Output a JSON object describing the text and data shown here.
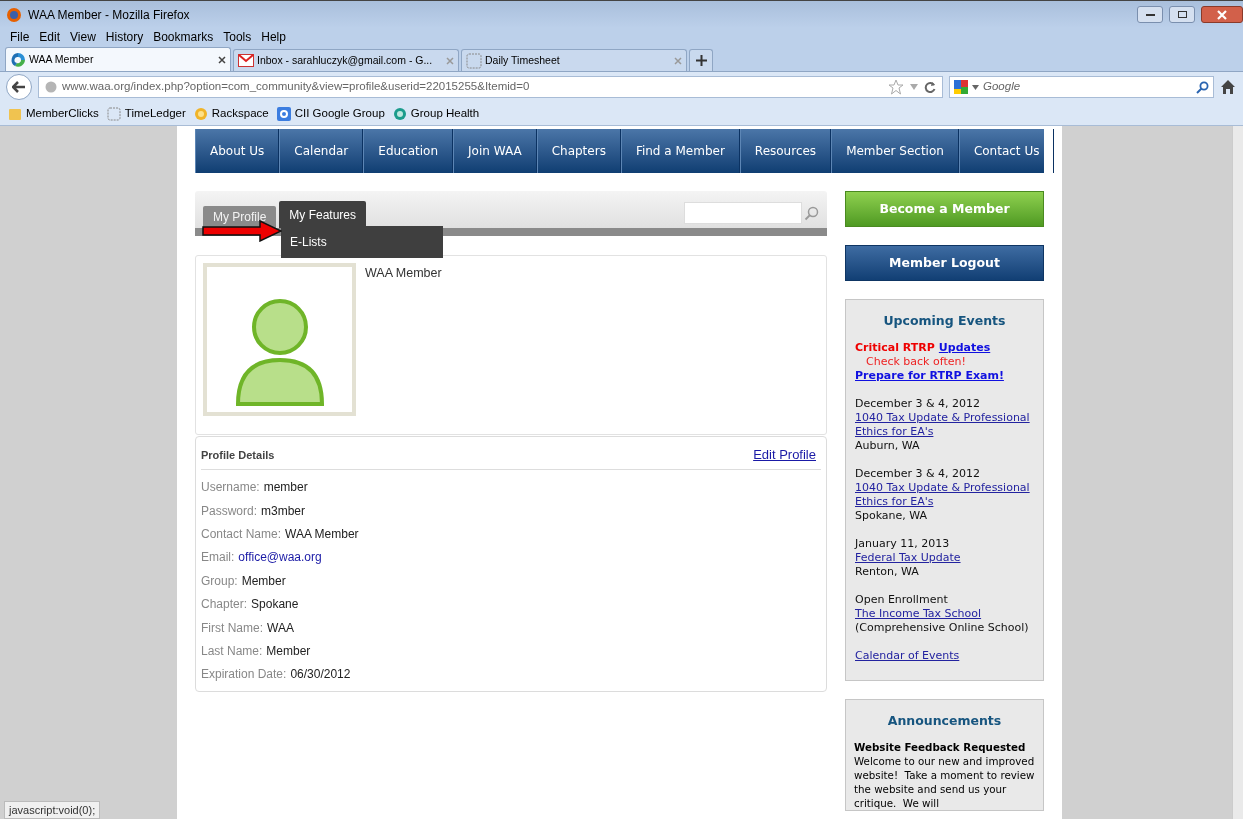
{
  "window": {
    "title": "WAA Member - Mozilla Firefox"
  },
  "menu": [
    "File",
    "Edit",
    "View",
    "History",
    "Bookmarks",
    "Tools",
    "Help"
  ],
  "tabs": [
    {
      "label": "WAA Member",
      "selected": true
    },
    {
      "label": "Inbox - sarahluczyk@gmail.com - G...",
      "selected": false
    },
    {
      "label": "Daily Timesheet",
      "selected": false
    }
  ],
  "address_bar": {
    "url": "www.waa.org/index.php?option=com_community&view=profile&userid=22015255&Itemid=0"
  },
  "search_bar": {
    "placeholder": "Google"
  },
  "bookmarks": [
    "MemberClicks",
    "TimeLedger",
    "Rackspace",
    "CII Google Group",
    "Group Health"
  ],
  "site_nav": [
    "About Us",
    "Calendar",
    "Education",
    "Join WAA",
    "Chapters",
    "Find a Member",
    "Resources",
    "Member Section",
    "Contact Us"
  ],
  "profile_tabs": [
    {
      "label": "My Profile",
      "selected": false
    },
    {
      "label": "My Features",
      "selected": true
    }
  ],
  "dropdown": {
    "items": [
      "E-Lists"
    ]
  },
  "profile": {
    "name": "WAA Member"
  },
  "details": {
    "title": "Profile Details",
    "edit_link": "Edit Profile",
    "fields": [
      {
        "label": "Username:",
        "value": "member",
        "kind": "text"
      },
      {
        "label": "Password:",
        "value": "m3mber",
        "kind": "text"
      },
      {
        "label": "Contact Name:",
        "value": "WAA Member",
        "kind": "text"
      },
      {
        "label": "Email:",
        "value": "office@waa.org",
        "kind": "link"
      },
      {
        "label": "Group:",
        "value": "Member",
        "kind": "text"
      },
      {
        "label": "Chapter:",
        "value": "Spokane",
        "kind": "text"
      },
      {
        "label": "First Name:",
        "value": "WAA",
        "kind": "text"
      },
      {
        "label": "Last Name:",
        "value": "Member",
        "kind": "text"
      },
      {
        "label": "Expiration Date:",
        "value": "06/30/2012",
        "kind": "text"
      }
    ]
  },
  "sidebar": {
    "join_button": "Become a Member",
    "logout_button": "Member Logout",
    "events": {
      "title": "Upcoming Events",
      "alert": "Critical RTRP",
      "alert_link": "Updates",
      "note": "Check back often!",
      "exam_link": "Prepare for RTRP Exam!",
      "items": [
        {
          "heading": "December 3 & 4, 2012",
          "link": "1040 Tax Update & Professional Ethics for EA's",
          "detail": "Auburn, WA"
        },
        {
          "heading": "December 3 & 4, 2012",
          "link": "1040 Tax Update & Professional Ethics for EA's",
          "detail": "Spokane, WA"
        },
        {
          "heading": "January 11, 2013",
          "link": "Federal Tax Update",
          "detail": "Renton, WA"
        },
        {
          "heading": "Open Enrollment",
          "link": "The Income Tax School",
          "detail": "(Comprehensive Online School)"
        }
      ],
      "calendar_link": "Calendar of Events"
    },
    "announcements": {
      "title": "Announcements",
      "heading": "Website Feedback Requested",
      "text": "Welcome to our new and improved website!  Take a moment to review the website and send us your critique.  We will"
    }
  },
  "status_bar": {
    "text": "javascript:void(0);"
  }
}
